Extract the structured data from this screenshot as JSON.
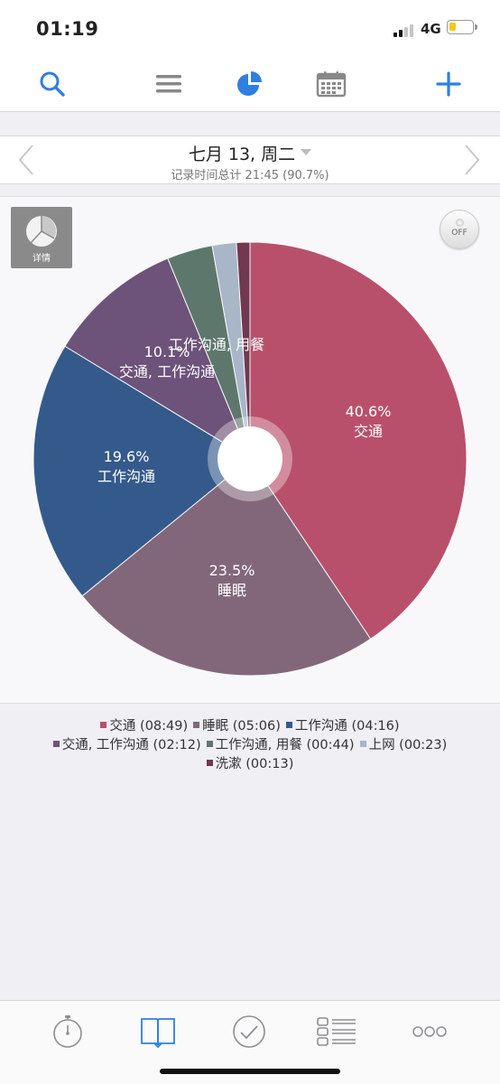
{
  "status_bar": {
    "time": "01:19",
    "network": "4G"
  },
  "toolbar": {
    "icons": [
      "search-icon",
      "menu-icon",
      "pie-chart-icon",
      "calendar-icon",
      "plus-icon"
    ],
    "accent": "#2f7fe0"
  },
  "date_header": {
    "title": "七月 13, 周二",
    "subtitle": "记录时间总计 21:45 (90.7%)"
  },
  "detail_button": {
    "label": "详情"
  },
  "toggle": {
    "label": "OFF"
  },
  "chart_data": {
    "type": "pie",
    "slices": [
      {
        "name": "交通",
        "duration": "08:49",
        "percent": 40.6,
        "color": "#b9506b",
        "label_pct": "40.6%"
      },
      {
        "name": "睡眠",
        "duration": "05:06",
        "percent": 23.5,
        "color": "#82677a",
        "label_pct": "23.5%"
      },
      {
        "name": "工作沟通",
        "duration": "04:16",
        "percent": 19.6,
        "color": "#345a8c",
        "label_pct": "19.6%"
      },
      {
        "name": "交通, 工作沟通",
        "duration": "02:12",
        "percent": 10.1,
        "color": "#6d5279",
        "label_pct": "10.1%"
      },
      {
        "name": "工作沟通, 用餐",
        "duration": "00:44",
        "percent": 3.4,
        "color": "#5e776d",
        "label_pct": ""
      },
      {
        "name": "上网",
        "duration": "00:23",
        "percent": 1.8,
        "color": "#a8b6c8",
        "label_pct": ""
      },
      {
        "name": "洗漱",
        "duration": "00:13",
        "percent": 1.0,
        "color": "#72384f",
        "label_pct": ""
      }
    ],
    "legend_rows": [
      [
        "交通 (08:49)",
        "睡眠 (05:06)",
        "工作沟通 (04:16)"
      ],
      [
        "交通, 工作沟通 (02:12)",
        "工作沟通, 用餐 (00:44)",
        "上网 (00:23)"
      ],
      [
        "洗漱 (00:13)"
      ]
    ]
  },
  "tab_bar": {
    "icons": [
      "stopwatch-icon",
      "book-icon",
      "check-circle-icon",
      "list-icon",
      "more-icon"
    ],
    "active_index": 1
  }
}
